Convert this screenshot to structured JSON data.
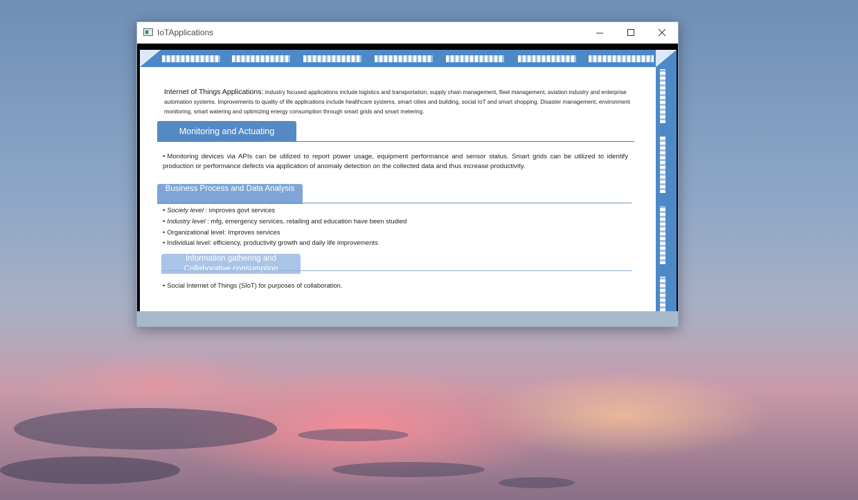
{
  "window": {
    "title": "IoTApplications",
    "controls": {
      "minimize": "—",
      "maximize": "☐",
      "close": "✕"
    }
  },
  "slide": {
    "intro_heading": "Internet of Things Applications:",
    "intro_text": "Industry focused applications include logistics and transportation, supply chain management, fleet management, aviation industry and enterprise automation systems. Improvements to quality of life applications include healthcare systems, smart cities and building, social IoT and smart shopping.  Disaster management, environment monitoring, smart watering and optimizing energy consumption through smart grids and smart metering.",
    "sections": [
      {
        "title": "Monitoring and Actuating",
        "bullets": [
          "Monitoring devices via APIs can be utilized to report power usage, equipment performance and sensor status. Smart grids can be utilized to identify production or performance defects via application of anomaly detection on the collected data and thus increase productivity."
        ]
      },
      {
        "title": "Business Process and Data Analysis",
        "bullets": [
          {
            "label": "Society level",
            "text": "  : improves govt services"
          },
          {
            "label": "Industry level",
            "text": " : mfg, emergency services, retailing and education have been studied"
          },
          {
            "label": "",
            "text": "Organizational level: Improves services"
          },
          {
            "label": "",
            "text": "Individual level:  efficiency, productivity growth and daily life improvements"
          }
        ]
      },
      {
        "title": "Information gathering and Collaborative consumption",
        "bullets": [
          "Social Internet of Things (SIoT) for purposes of collaboration."
        ]
      }
    ]
  },
  "colors": {
    "accent": "#4e89c7",
    "tab_dark": "#5589c5",
    "tab_mid": "#7ea5d6",
    "tab_light": "#a9c4e6"
  }
}
